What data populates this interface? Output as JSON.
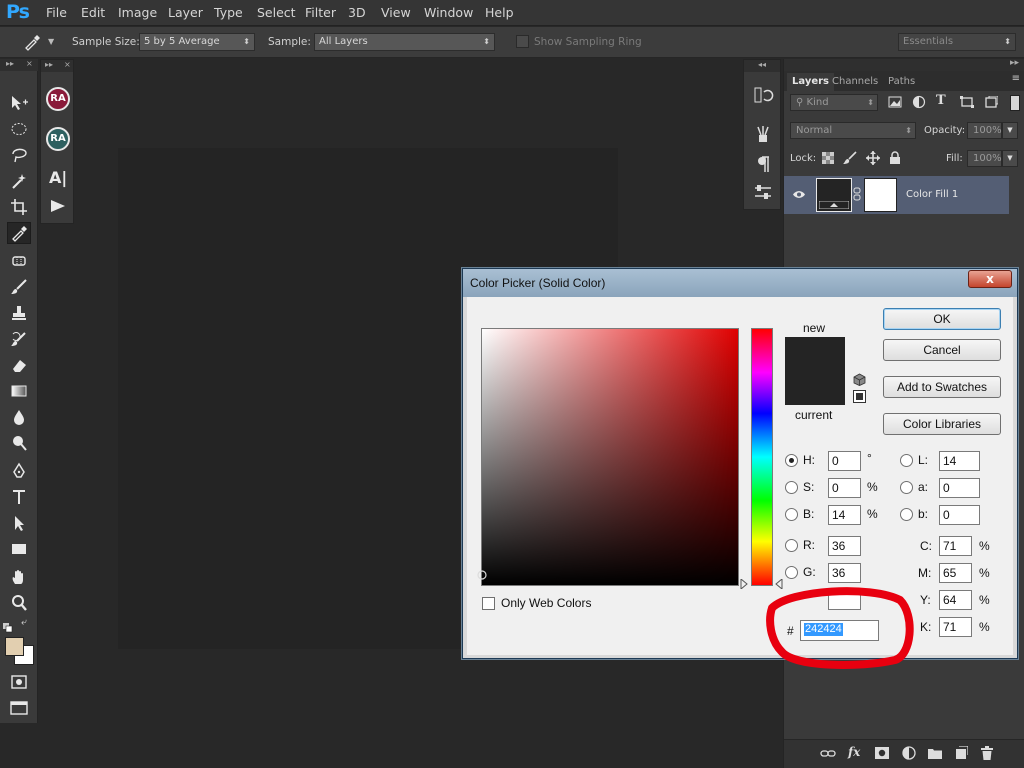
{
  "app": {
    "logo": "Ps"
  },
  "menu": [
    "File",
    "Edit",
    "Image",
    "Layer",
    "Type",
    "Select",
    "Filter",
    "3D",
    "View",
    "Window",
    "Help"
  ],
  "options_bar": {
    "sample_size_label": "Sample Size:",
    "sample_size_value": "5 by 5 Average",
    "sample_label": "Sample:",
    "sample_value": "All Layers",
    "show_sampling_ring": "Show Sampling Ring",
    "workspace": "Essentials"
  },
  "mini_panel": {
    "avatar1": "RA",
    "avatar2": "RA",
    "avatar1_color": "#8a1a3a",
    "avatar2_color": "#2e6060"
  },
  "layers_panel": {
    "tabs": [
      "Layers",
      "Channels",
      "Paths"
    ],
    "filter_kind": "Kind",
    "blend_mode": "Normal",
    "opacity_label": "Opacity:",
    "opacity_value": "100%",
    "lock_label": "Lock:",
    "fill_label": "Fill:",
    "fill_value": "100%",
    "layer_name": "Color Fill 1"
  },
  "color_picker": {
    "title": "Color Picker (Solid Color)",
    "close": "x",
    "buttons": {
      "ok": "OK",
      "cancel": "Cancel",
      "add_to_swatches": "Add to Swatches",
      "color_libraries": "Color Libraries"
    },
    "new_label": "new",
    "current_label": "current",
    "new_color": "#242424",
    "current_color": "#242424",
    "only_web_colors": "Only Web Colors",
    "fields": {
      "H": {
        "label": "H:",
        "value": "0",
        "unit": "°"
      },
      "S": {
        "label": "S:",
        "value": "0",
        "unit": "%"
      },
      "B": {
        "label": "B:",
        "value": "14",
        "unit": "%"
      },
      "R": {
        "label": "R:",
        "value": "36"
      },
      "G": {
        "label": "G:",
        "value": "36"
      },
      "L": {
        "label": "L:",
        "value": "14"
      },
      "a": {
        "label": "a:",
        "value": "0"
      },
      "b": {
        "label": "b:",
        "value": "0"
      },
      "C": {
        "label": "C:",
        "value": "71",
        "unit": "%"
      },
      "M": {
        "label": "M:",
        "value": "65",
        "unit": "%"
      },
      "Y": {
        "label": "Y:",
        "value": "64",
        "unit": "%"
      },
      "K": {
        "label": "K:",
        "value": "71",
        "unit": "%"
      }
    },
    "hex_label": "#",
    "hex_value": "242424"
  },
  "colors": {
    "annotation_red": "#e8000f",
    "selection_blue": "#3399ff",
    "layer_row_selected": "#545e74"
  }
}
